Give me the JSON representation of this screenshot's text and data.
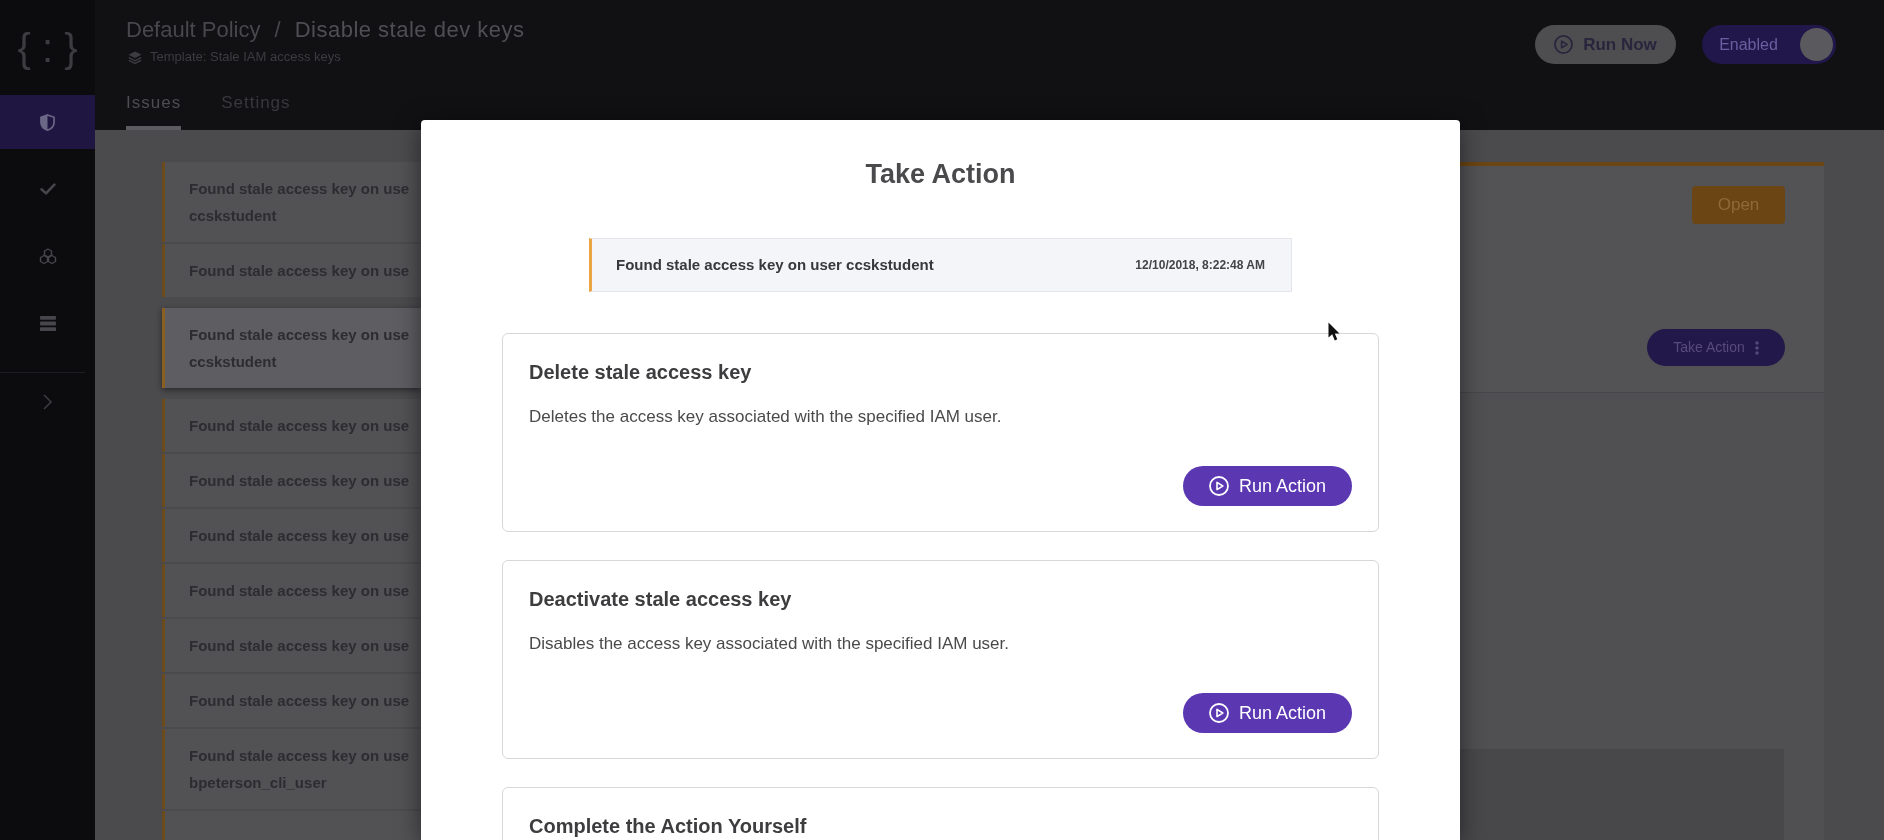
{
  "sidebar": {
    "logo": "{ : }",
    "items": [
      {
        "selected": true
      },
      {
        "selected": false
      },
      {
        "selected": false
      },
      {
        "selected": false
      }
    ]
  },
  "header": {
    "breadcrumb": {
      "parent": "Default Policy",
      "separator": "/",
      "current": "Disable stale dev keys"
    },
    "template": "Template: Stale IAM access keys",
    "tabs": [
      {
        "label": "Issues",
        "selected": true
      },
      {
        "label": "Settings",
        "selected": false
      }
    ],
    "run_button": {
      "label": "Run Now"
    },
    "enabled_toggle": {
      "label": "Enabled",
      "on": true
    }
  },
  "issues": [
    {
      "lines": [
        "Found stale access key on use",
        "ccskstudent"
      ],
      "selected": false
    },
    {
      "lines": [
        "Found stale access key on use"
      ],
      "selected": false
    },
    {
      "lines": [
        "Found stale access key on use",
        "ccskstudent"
      ],
      "selected": true
    },
    {
      "lines": [
        "Found stale access key on use"
      ],
      "selected": false
    },
    {
      "lines": [
        "Found stale access key on use"
      ],
      "selected": false
    },
    {
      "lines": [
        "Found stale access key on use"
      ],
      "selected": false
    },
    {
      "lines": [
        "Found stale access key on use"
      ],
      "selected": false
    },
    {
      "lines": [
        "Found stale access key on use"
      ],
      "selected": false
    },
    {
      "lines": [
        "Found stale access key on use"
      ],
      "selected": false
    },
    {
      "lines": [
        "Found stale access key on use",
        "bpeterson_cli_user"
      ],
      "selected": false
    },
    {
      "selected": false
    }
  ],
  "detail": {
    "status_button": {
      "label": "Open"
    },
    "action_button": {
      "label": "Take Action"
    }
  },
  "modal": {
    "title": "Take Action",
    "issue": {
      "text": "Found stale access key on user ccskstudent",
      "time": "12/10/2018, 8:22:48 AM"
    },
    "actions": [
      {
        "title": "Delete stale access key",
        "description": "Deletes the access key associated with the specified IAM user.",
        "button": "Run Action"
      },
      {
        "title": "Deactivate stale access key",
        "description": "Disables the access key associated with the specified IAM user.",
        "button": "Run Action"
      },
      {
        "title": "Complete the Action Yourself"
      }
    ]
  }
}
